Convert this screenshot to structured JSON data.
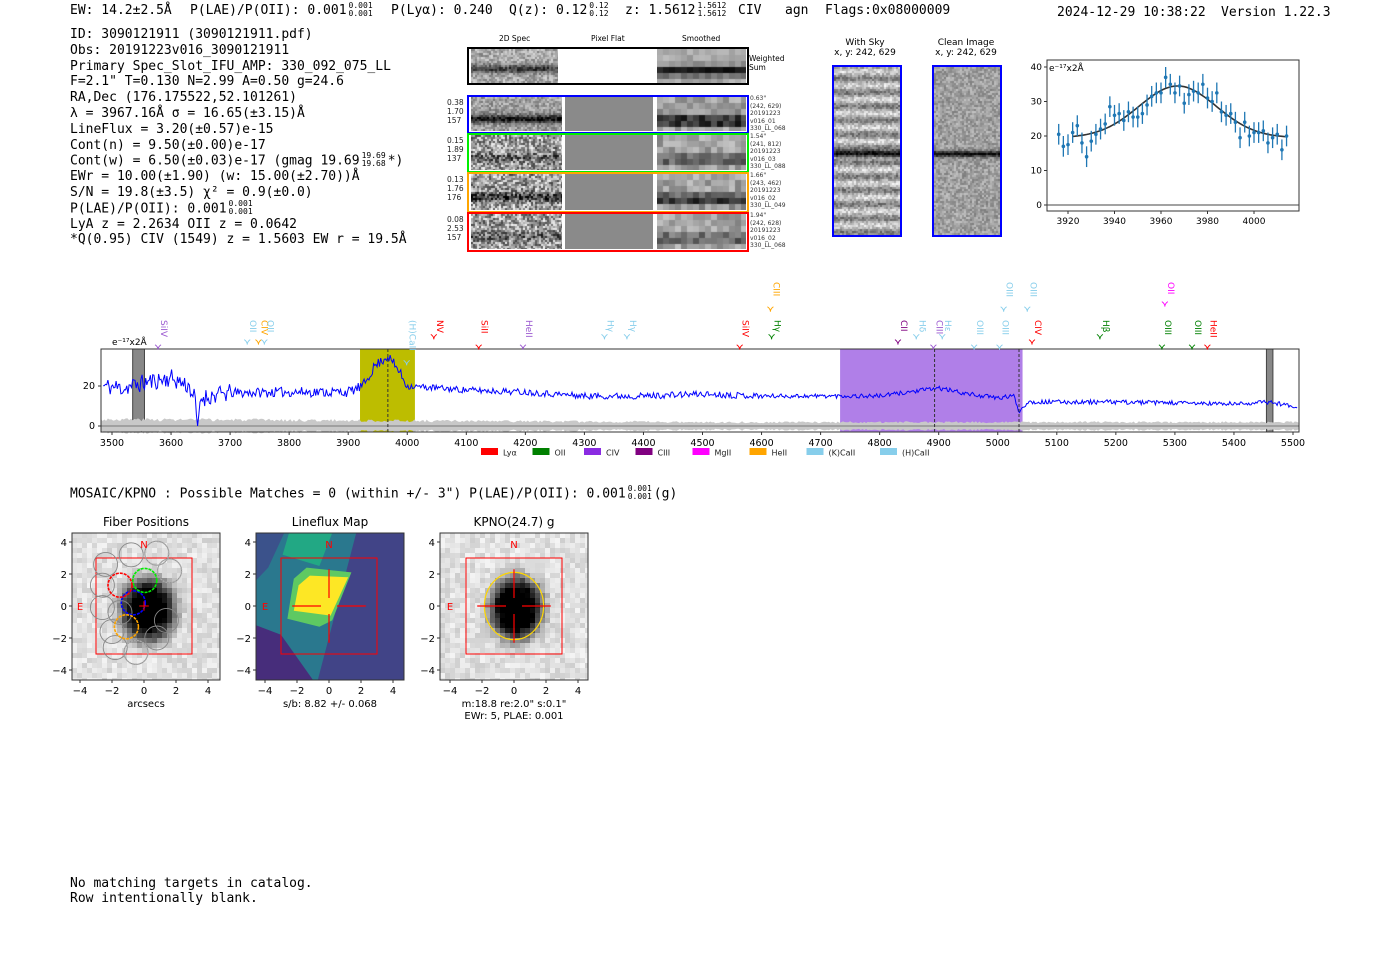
{
  "header": {
    "ew": "EW: 14.2±2.5Å",
    "plae_label": "P(LAE)/P(OII): 0.001",
    "plae_hi": "0.001",
    "plae_lo": "0.001",
    "plya": "P(Lyα): 0.240",
    "qz_label": "Q(z): 0.12",
    "qz_hi": "0.12",
    "qz_lo": "0.12",
    "z_label": "z: 1.5612",
    "z_hi": "1.5612",
    "z_lo": "1.5612",
    "line": "CIV",
    "classification": "agn",
    "flags": "Flags:0x08000009",
    "datetime": "2024-12-29 10:38:22",
    "version": "Version 1.22.3"
  },
  "info": {
    "id": "ID: 3090121911 (3090121911.pdf)",
    "obs": "Obs: 20191223v016_3090121911",
    "primary": "Primary Spec_Slot_IFU_AMP: 330_092_075_LL",
    "params": "F=2.1\"  T=0.130  N=2.99  A=0.50  g=24.6",
    "radec": "RA,Dec (176.175522,52.101261)",
    "lambda": "λ = 3967.16Å  σ = 16.65(±3.15)Å",
    "lineflux": "LineFlux = 3.20(±0.57)e-15",
    "cont_n": "Cont(n) = 9.50(±0.00)e-17",
    "cont_w": "Cont(w) = 6.50(±0.03)e-17 (gmag 19.69",
    "cont_w_hi": "19.69",
    "cont_w_lo": "19.68",
    "cont_w_suffix": "*)",
    "ewr": "EWr = 10.00(±1.90) (w: 15.00(±2.70))Å",
    "sn": "S/N = 19.8(±3.5)  χ² = 0.9(±0.0)",
    "plae": "P(LAE)/P(OII): 0.001",
    "plae_hi": "0.001",
    "plae_lo": "0.001",
    "redshifts": "LyA z = 2.2634  OII z = 0.0642",
    "q": "*Q(0.95) CIV (1549) z = 1.5603  EW r = 19.5Å"
  },
  "cutouts": {
    "col_titles": [
      "2D Spec",
      "Pixel Flat",
      "Smoothed"
    ],
    "weighted_label": "Weighted Sum",
    "rows": [
      {
        "color": "#0000ff",
        "left": [
          "0.38",
          "1.70",
          "157"
        ],
        "right": [
          "0.63\"",
          "(242, 629)",
          "20191223",
          "v016_01",
          "330_LL_068"
        ]
      },
      {
        "color": "#00ee00",
        "left": [
          "0.15",
          "1.89",
          "137"
        ],
        "right": [
          "1.54\"",
          "(241, 812)",
          "20191223",
          "v016_03",
          "330_LL_088"
        ]
      },
      {
        "color": "#ffa500",
        "left": [
          "0.13",
          "1.76",
          "176"
        ],
        "right": [
          "1.66\"",
          "(243, 462)",
          "20191223",
          "v016_02",
          "330_LL_049"
        ]
      },
      {
        "color": "#ff0000",
        "left": [
          "0.08",
          "2.53",
          "157"
        ],
        "right": [
          "1.94\"",
          "(242, 628)",
          "20191223",
          "v016_02",
          "330_LL_068"
        ]
      }
    ],
    "with_sky_title": "With Sky",
    "with_sky_xy": "x, y: 242, 629",
    "clean_title": "Clean Image",
    "clean_xy": "x, y: 242, 629"
  },
  "chart_data": [
    {
      "type": "scatter",
      "name_hint": "line fit",
      "unit_label": "e⁻¹⁷x2Å",
      "xlim": [
        3912,
        4018
      ],
      "ylim": [
        -2,
        41
      ],
      "xticks": [
        3920,
        3940,
        3960,
        3980,
        4000
      ],
      "yticks": [
        0,
        10,
        20,
        30,
        40
      ],
      "point_color": "#1f77b4",
      "points": [
        [
          3916,
          20.5
        ],
        [
          3918,
          17
        ],
        [
          3920,
          17.5
        ],
        [
          3922,
          21
        ],
        [
          3924,
          23
        ],
        [
          3926,
          18
        ],
        [
          3928,
          14
        ],
        [
          3930,
          18.5
        ],
        [
          3932,
          20.5
        ],
        [
          3934,
          22
        ],
        [
          3936,
          23.5
        ],
        [
          3938,
          28.5
        ],
        [
          3940,
          26
        ],
        [
          3942,
          26.5
        ],
        [
          3944,
          24.5
        ],
        [
          3946,
          27
        ],
        [
          3948,
          25.5
        ],
        [
          3950,
          25.5
        ],
        [
          3952,
          26.5
        ],
        [
          3954,
          29
        ],
        [
          3956,
          31.5
        ],
        [
          3958,
          32.5
        ],
        [
          3960,
          32.5
        ],
        [
          3962,
          37
        ],
        [
          3964,
          35
        ],
        [
          3966,
          32.5
        ],
        [
          3968,
          34.5
        ],
        [
          3970,
          29.5
        ],
        [
          3972,
          32
        ],
        [
          3974,
          33
        ],
        [
          3976,
          32.5
        ],
        [
          3978,
          35
        ],
        [
          3980,
          31
        ],
        [
          3982,
          30
        ],
        [
          3984,
          32.5
        ],
        [
          3986,
          27
        ],
        [
          3988,
          26
        ],
        [
          3990,
          26.5
        ],
        [
          3992,
          24
        ],
        [
          3994,
          19.5
        ],
        [
          3996,
          24
        ],
        [
          3998,
          20
        ],
        [
          4000,
          21
        ],
        [
          4002,
          21
        ],
        [
          4004,
          21.5
        ],
        [
          4006,
          18
        ],
        [
          4008,
          19.5
        ],
        [
          4010,
          20.5
        ],
        [
          4012,
          16
        ],
        [
          4014,
          20
        ]
      ],
      "error": 3,
      "fit": {
        "center": 3967.16,
        "sigma": 16.65,
        "continuum": 19.5,
        "amplitude": 15,
        "range": [
          3922,
          4014
        ],
        "color": "#333333"
      }
    },
    {
      "type": "line",
      "unit_label": "e⁻¹⁷x2Å",
      "xlim": [
        3481,
        5510
      ],
      "ylim": [
        -3,
        38.5
      ],
      "xticks": [
        3500,
        3600,
        3700,
        3800,
        3900,
        4000,
        4100,
        4200,
        4300,
        4400,
        4500,
        4600,
        4700,
        4800,
        4900,
        5000,
        5100,
        5200,
        5300,
        5400,
        5500
      ],
      "yticks": [
        0,
        20
      ],
      "line_color": "#0000ff",
      "flux_anchors": [
        [
          3485,
          20
        ],
        [
          3520,
          19
        ],
        [
          3560,
          22
        ],
        [
          3600,
          24
        ],
        [
          3630,
          20
        ],
        [
          3640,
          14
        ],
        [
          3645,
          0
        ],
        [
          3650,
          14
        ],
        [
          3700,
          16.5
        ],
        [
          3800,
          17
        ],
        [
          3900,
          17
        ],
        [
          3925,
          20
        ],
        [
          3945,
          30
        ],
        [
          3967,
          35
        ],
        [
          3985,
          28
        ],
        [
          4000,
          20
        ],
        [
          4050,
          19
        ],
        [
          4100,
          18
        ],
        [
          4200,
          17
        ],
        [
          4300,
          15
        ],
        [
          4400,
          15
        ],
        [
          4500,
          16
        ],
        [
          4600,
          15
        ],
        [
          4700,
          15
        ],
        [
          4800,
          15
        ],
        [
          4850,
          17
        ],
        [
          4900,
          19
        ],
        [
          4950,
          16
        ],
        [
          5000,
          14
        ],
        [
          5028,
          15
        ],
        [
          5036,
          7
        ],
        [
          5050,
          12
        ],
        [
          5100,
          12
        ],
        [
          5200,
          12
        ],
        [
          5300,
          11.5
        ],
        [
          5400,
          11
        ],
        [
          5460,
          12
        ],
        [
          5500,
          10
        ]
      ],
      "shaded_regions": [
        {
          "range": [
            3920,
            4013
          ],
          "color": "#bdbd00"
        },
        {
          "range": [
            4733,
            5042
          ],
          "color": "#b07fe8"
        }
      ],
      "masked_regions": [
        [
          3535,
          3555
        ],
        [
          5455,
          5466
        ]
      ],
      "marked_wavelengths": [
        3967.16,
        4893,
        5036
      ],
      "line_labels": [
        {
          "text": "SiIV",
          "wave": 3578,
          "color": "#9b59d0",
          "row": "low"
        },
        {
          "text": "OII",
          "wave": 3729,
          "color": "#87ceeb",
          "row": "low"
        },
        {
          "text": "CIV",
          "wave": 3748,
          "color": "#ffa500",
          "row": "low"
        },
        {
          "text": "OII",
          "wave": 3758,
          "color": "#87ceeb",
          "row": "low"
        },
        {
          "text": "(H)CaII",
          "wave": 3999,
          "color": "#87ceeb",
          "row": "low"
        },
        {
          "text": "NV",
          "wave": 4045,
          "color": "#ff0000",
          "row": "low"
        },
        {
          "text": "SiII",
          "wave": 4121,
          "color": "#ff0000",
          "row": "low"
        },
        {
          "text": "HeII",
          "wave": 4196,
          "color": "#9b59d0",
          "row": "low"
        },
        {
          "text": "Hγ",
          "wave": 4334,
          "color": "#87ceeb",
          "row": "low"
        },
        {
          "text": "Hγ",
          "wave": 4372,
          "color": "#87ceeb",
          "row": "low"
        },
        {
          "text": "SiIV",
          "wave": 4563,
          "color": "#ff0000",
          "row": "low"
        },
        {
          "text": "CIII",
          "wave": 4615,
          "color": "#ffa500",
          "row": "high"
        },
        {
          "text": "Hγ",
          "wave": 4617,
          "color": "#008000",
          "row": "low"
        },
        {
          "text": "CII",
          "wave": 4831,
          "color": "#800080",
          "row": "low"
        },
        {
          "text": "Hδ",
          "wave": 4862,
          "color": "#87ceeb",
          "row": "low"
        },
        {
          "text": "CIII",
          "wave": 4891,
          "color": "#9b59d0",
          "row": "low"
        },
        {
          "text": "Hε",
          "wave": 4906,
          "color": "#87ceeb",
          "row": "low"
        },
        {
          "text": "OIII",
          "wave": 4960,
          "color": "#87ceeb",
          "row": "low"
        },
        {
          "text": "OIII",
          "wave": 5003,
          "color": "#87ceeb",
          "row": "low"
        },
        {
          "text": "OIII",
          "wave": 5010,
          "color": "#87ceeb",
          "row": "high"
        },
        {
          "text": "OIII",
          "wave": 5050,
          "color": "#87ceeb",
          "row": "high"
        },
        {
          "text": "CIV",
          "wave": 5058,
          "color": "#ff0000",
          "row": "low"
        },
        {
          "text": "Hβ",
          "wave": 5173,
          "color": "#008000",
          "row": "low"
        },
        {
          "text": "OII",
          "wave": 5283,
          "color": "#ff00ff",
          "row": "high"
        },
        {
          "text": "OIII",
          "wave": 5278,
          "color": "#008000",
          "row": "low"
        },
        {
          "text": "OIII",
          "wave": 5329,
          "color": "#008000",
          "row": "low"
        },
        {
          "text": "HeII",
          "wave": 5355,
          "color": "#ff0000",
          "row": "low"
        }
      ],
      "legend": [
        {
          "label": "Lyα",
          "color": "#ff0000"
        },
        {
          "label": "OII",
          "color": "#008000"
        },
        {
          "label": "CIV",
          "color": "#8a2be2"
        },
        {
          "label": "CIII",
          "color": "#800080"
        },
        {
          "label": "MgII",
          "color": "#ff00ff"
        },
        {
          "label": "HeII",
          "color": "#ffa500"
        },
        {
          "label": "(K)CaII",
          "color": "#87ceeb"
        },
        {
          "label": "(H)CaII",
          "color": "#87ceeb"
        }
      ],
      "legend_position": "bottom"
    }
  ],
  "imaging": {
    "summary": "MOSAIC/KPNO : Possible Matches = 0 (within +/- 3\")  P(LAE)/P(OII): 0.001",
    "summary_hi": "0.001",
    "summary_lo": "0.001",
    "summary_suffix": "(g)",
    "ticks": [
      "−4",
      "−2",
      "0",
      "2",
      "4"
    ],
    "compass_n": "N",
    "compass_e": "E",
    "panels": [
      {
        "title": "Fiber Positions",
        "caption": [
          "arcsecs"
        ]
      },
      {
        "title": "Lineflux Map",
        "caption": [
          "s/b: 8.82 +/- 0.068"
        ]
      },
      {
        "title": "KPNO(24.7) g",
        "caption": [
          "m:18.8  re:2.0\"  s:0.1\"",
          "EWr: 5, PLAE: 0.001"
        ]
      }
    ]
  },
  "footer": {
    "line1": "No matching targets in catalog.",
    "line2": "Row intentionally blank."
  }
}
